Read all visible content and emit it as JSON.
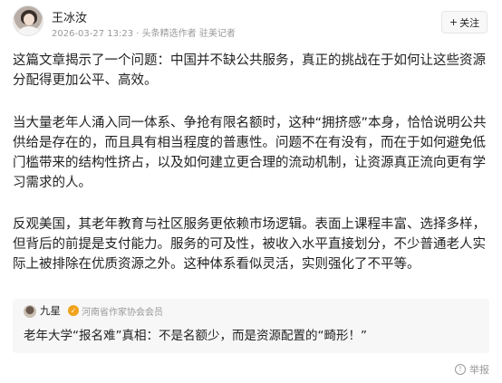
{
  "author": {
    "name": "王冰汝",
    "meta": "2026-03-27 13:23 · 头条精选作者 驻美记者",
    "follow_label": "关注"
  },
  "paragraphs": [
    "这篇文章揭示了一个问题：中国并不缺公共服务，真正的挑战在于如何让这些资源分配得更加公平、高效。",
    "当大量老年人涌入同一体系、争抢有限名额时，这种“拥挤感”本身，恰恰说明公共供给是存在的，而且具有相当程度的普惠性。问题不在有没有，而在于如何避免低门槛带来的结构性挤占，以及如何建立更合理的流动机制，让资源真正流向更有学习需求的人。",
    "反观美国，其老年教育与社区服务更依赖市场逻辑。表面上课程丰富、选择多样，但背后的前提是支付能力。服务的可及性，被收入水平直接划分，不少普通老人实际上被排除在优质资源之外。这种体系看似灵活，实则强化了不平等。"
  ],
  "quote": {
    "author": "九星",
    "org": "河南省作家协会会员",
    "text": "老年大学“报名难”真相：不是名额少，而是资源配置的“畸形！”"
  },
  "report_label": "举报",
  "icons": {
    "follow": "plus-icon",
    "report": "info-circle-icon",
    "badge": "verified-badge-icon"
  },
  "colors": {
    "meta_gray": "#999999",
    "badge_orange": "#f0a21a",
    "quote_bg": "#f7f7f7"
  }
}
